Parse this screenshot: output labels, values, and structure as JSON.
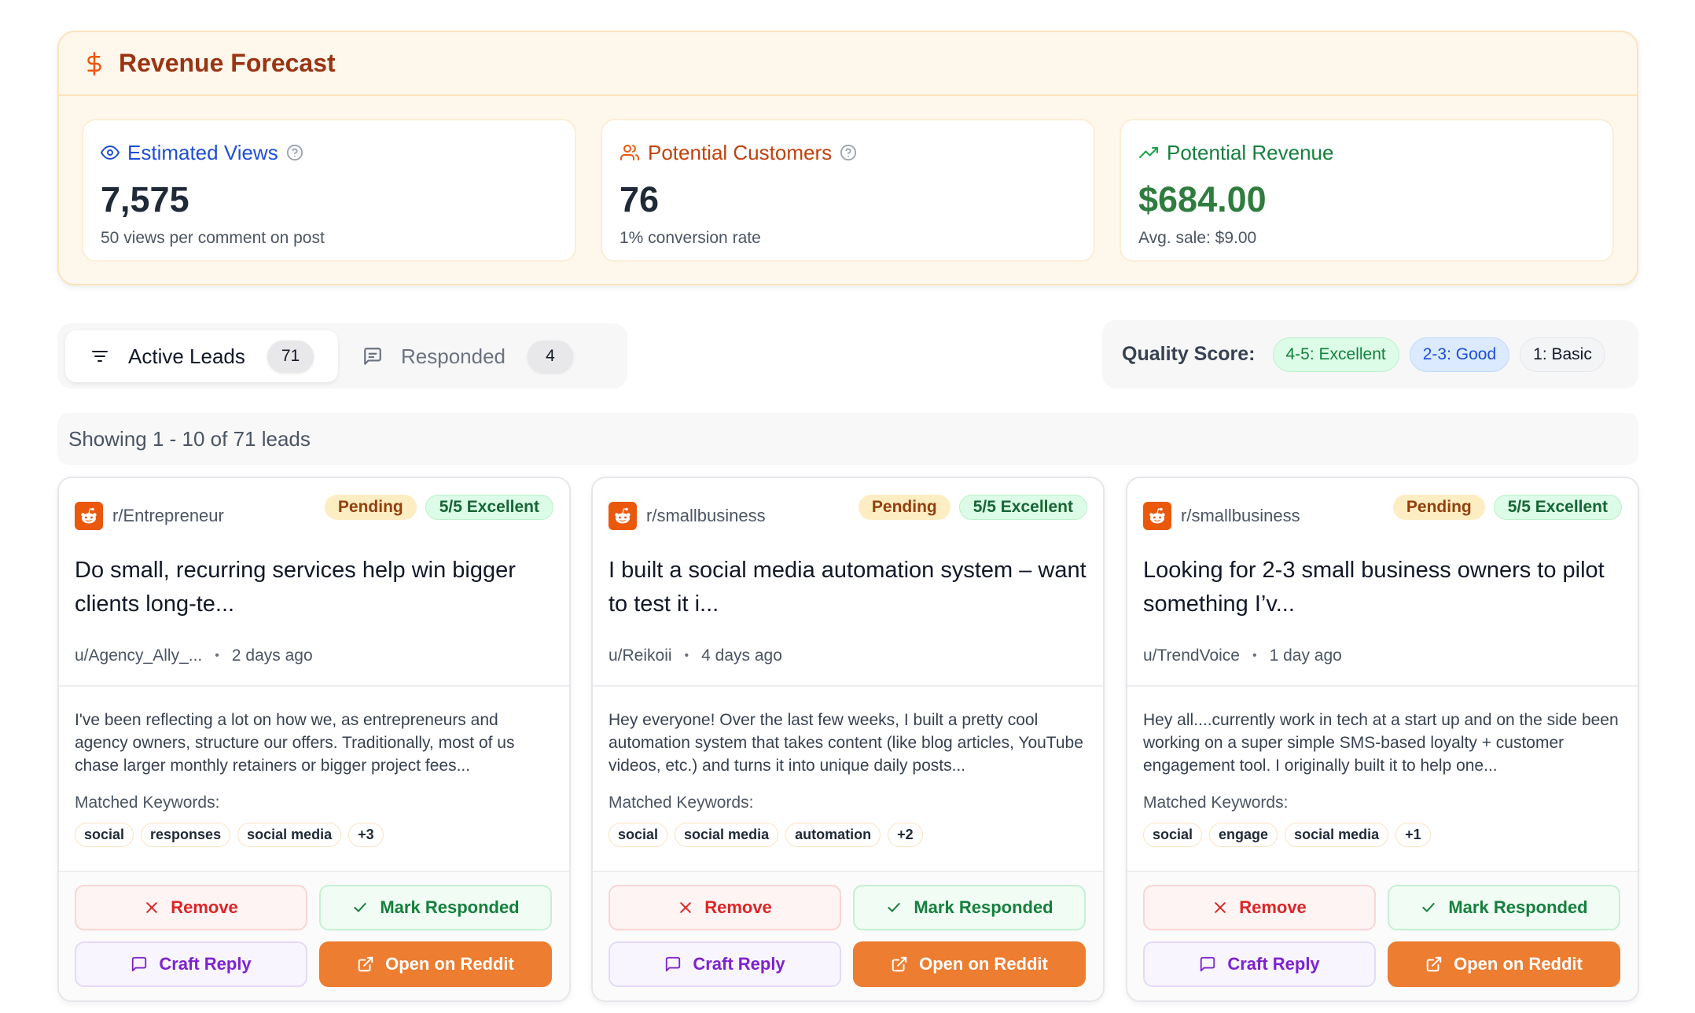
{
  "forecast": {
    "title": "Revenue Forecast",
    "icon": "dollar-icon",
    "metrics": [
      {
        "label": "Estimated Views",
        "value": "7,575",
        "sub": "50 views per comment on post",
        "color": "#1d4ed8",
        "icon": "eye-icon"
      },
      {
        "label": "Potential Customers",
        "value": "76",
        "sub": "1% conversion rate",
        "color": "#c2410c",
        "icon": "users-icon"
      },
      {
        "label": "Potential Revenue",
        "value": "$684.00",
        "sub": "Avg. sale: $9.00",
        "color": "#15803d",
        "icon": "trending-up-icon"
      }
    ]
  },
  "tabs": [
    {
      "label": "Active Leads",
      "count": "71",
      "icon": "filter-icon"
    },
    {
      "label": "Responded",
      "count": "4",
      "icon": "message-icon"
    }
  ],
  "quality": {
    "label": "Quality Score:",
    "levels": [
      {
        "label": "4-5: Excellent",
        "bg": "#dcfce7",
        "fg": "#15803d",
        "border": "#bbf0cb"
      },
      {
        "label": "2-3: Good",
        "bg": "#dbeafe",
        "fg": "#1d4ed8",
        "border": "#c1d8fb"
      },
      {
        "label": "1: Basic",
        "bg": "#f3f4f6",
        "fg": "#111827",
        "border": "#e5e7eb"
      }
    ]
  },
  "showing": "Showing 1 - 10 of 71 leads",
  "actions": {
    "remove": "Remove",
    "mark": "Mark Responded",
    "craft": "Craft Reply",
    "open": "Open on Reddit"
  },
  "leads": [
    {
      "subreddit": "r/Entrepreneur",
      "status": "Pending",
      "score": "5/5 Excellent",
      "title": "Do small, recurring services help win bigger clients long-te...",
      "author": "u/Agency_Ally_...",
      "time": "2 days ago",
      "excerpt": "I've been reflecting a lot on how we, as entrepreneurs and agency owners, structure our offers. Traditionally, most of us chase larger monthly retainers or bigger project fees...",
      "keywords_label": "Matched Keywords:",
      "keywords": [
        "social",
        "responses",
        "social media",
        "+3"
      ]
    },
    {
      "subreddit": "r/smallbusiness",
      "status": "Pending",
      "score": "5/5 Excellent",
      "title": "I built a social media automation system – want to test it i...",
      "author": "u/Reikoii",
      "time": "4 days ago",
      "excerpt": "Hey everyone! Over the last few weeks, I built a pretty cool automation system that takes content (like blog articles, YouTube videos, etc.) and turns it into unique daily posts...",
      "keywords_label": "Matched Keywords:",
      "keywords": [
        "social",
        "social media",
        "automation",
        "+2"
      ]
    },
    {
      "subreddit": "r/smallbusiness",
      "status": "Pending",
      "score": "5/5 Excellent",
      "title": "Looking for 2-3 small business owners to pilot something I’v...",
      "author": "u/TrendVoice",
      "time": "1 day ago",
      "excerpt": "Hey all....currently work in tech at a start up and on the side been working on a super simple SMS-based loyalty + customer engagement tool. I originally built it to help one...",
      "keywords_label": "Matched Keywords:",
      "keywords": [
        "social",
        "engage",
        "social media",
        "+1"
      ]
    }
  ]
}
